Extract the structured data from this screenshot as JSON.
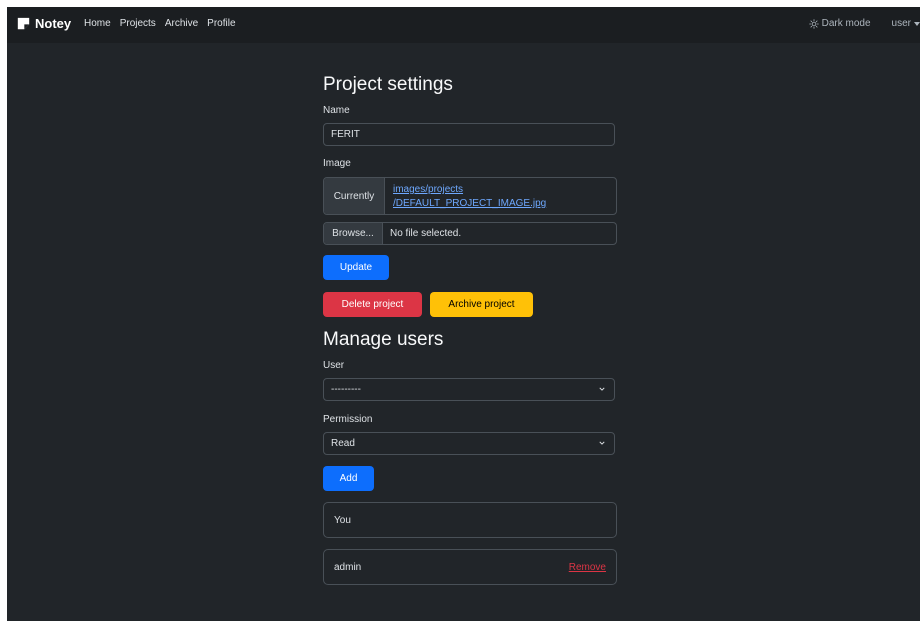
{
  "navbar": {
    "brand": "Notey",
    "links": [
      "Home",
      "Projects",
      "Archive",
      "Profile"
    ],
    "dark_mode_label": "Dark mode",
    "user_label": "user"
  },
  "settings": {
    "title": "Project settings",
    "name_label": "Name",
    "name_value": "FERIT",
    "image_label": "Image",
    "currently_label": "Currently",
    "current_image_line1": "images/projects",
    "current_image_line2": "/DEFAULT_PROJECT_IMAGE.jpg",
    "browse_label": "Browse...",
    "file_status": "No file selected.",
    "update_label": "Update",
    "delete_label": "Delete project",
    "archive_label": "Archive project"
  },
  "manage": {
    "title": "Manage users",
    "user_label": "User",
    "user_selected": "---------",
    "permission_label": "Permission",
    "permission_selected": "Read",
    "add_label": "Add",
    "members": [
      {
        "name": "You",
        "action": ""
      },
      {
        "name": "admin",
        "action": "Remove"
      }
    ]
  },
  "colors": {
    "background": "#212529",
    "navbar": "#1b1e21",
    "primary": "#0d6efd",
    "danger": "#dc3545",
    "warning": "#ffc107",
    "link": "#6ea8fe"
  }
}
